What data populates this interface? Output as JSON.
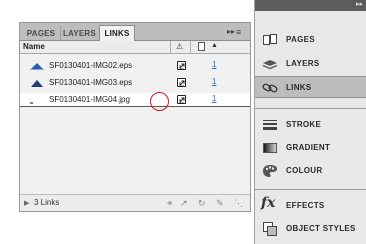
{
  "links_panel": {
    "tabs": [
      "PAGES",
      "LAYERS",
      "LINKS"
    ],
    "active_tab": "LINKS",
    "column_name": "Name",
    "links": [
      {
        "name": "SF0130401-IMG02.eps",
        "page": "1"
      },
      {
        "name": "SF0130401-IMG03.eps",
        "page": "1"
      },
      {
        "name": "SF0130401-IMG04.jpg",
        "page": "1"
      }
    ],
    "footer_count": "3 Links"
  },
  "dock": {
    "items": [
      {
        "label": "PAGES",
        "icon": "pages-icon"
      },
      {
        "label": "LAYERS",
        "icon": "layers-icon"
      },
      {
        "label": "LINKS",
        "icon": "links-icon"
      },
      {
        "label": "STROKE",
        "icon": "stroke-icon"
      },
      {
        "label": "GRADIENT",
        "icon": "gradient-icon"
      },
      {
        "label": "COLOUR",
        "icon": "colour-icon"
      },
      {
        "label": "EFFECTS",
        "icon": "fx-icon"
      },
      {
        "label": "OBJECT STYLES",
        "icon": "object-styles-icon"
      }
    ],
    "active_item": "LINKS"
  },
  "colors": {
    "highlight_circle": "#d01515",
    "page_link": "#3366cc"
  }
}
